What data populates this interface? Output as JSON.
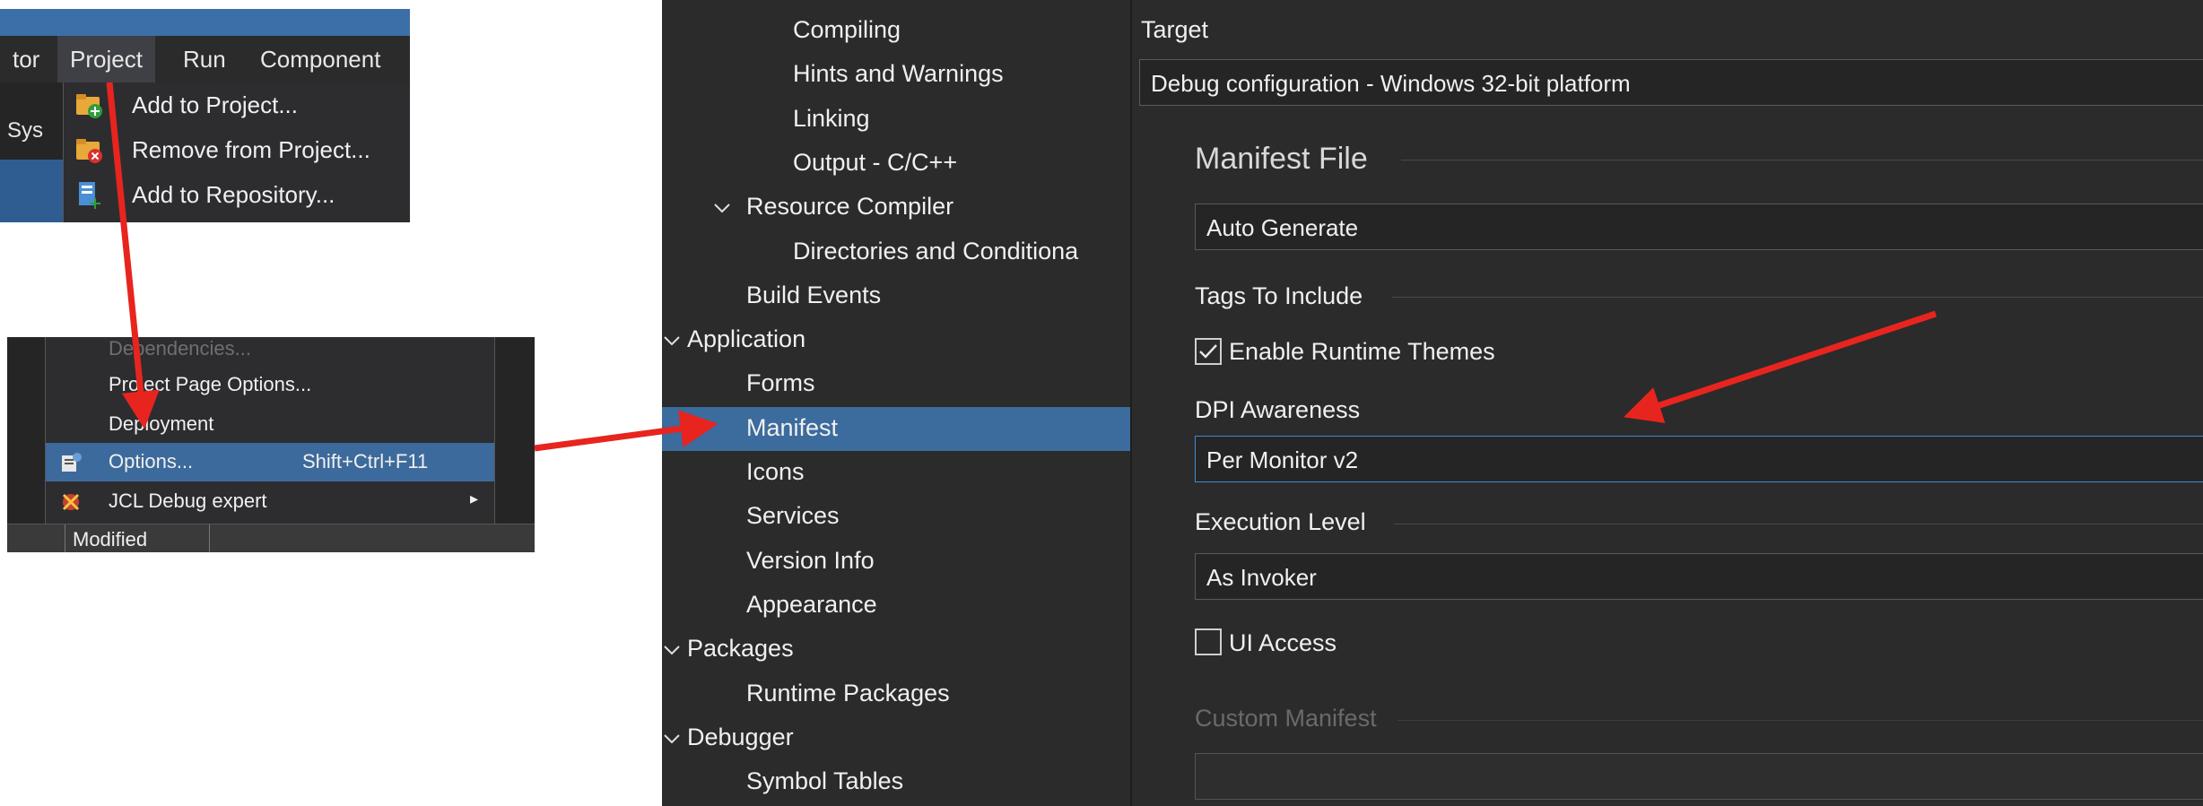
{
  "crop1": {
    "menubar": [
      "tor",
      "Project",
      "Run",
      "Component"
    ],
    "sys_label": "Sys",
    "dropdown": [
      {
        "label": "Add to Project...",
        "icon": "folder-add-icon"
      },
      {
        "label": "Remove from Project...",
        "icon": "folder-remove-icon"
      },
      {
        "label": "Add to Repository...",
        "icon": "repository-add-icon"
      }
    ]
  },
  "crop2": {
    "items": [
      {
        "label": "Dependencies...",
        "faded": true
      },
      {
        "label": "Project Page Options..."
      },
      {
        "label": "Deployment"
      },
      {
        "label": "Options...",
        "shortcut": "Shift+Ctrl+F11",
        "highlighted": true,
        "icon": "options-icon"
      },
      {
        "label": "JCL Debug expert",
        "submenu": true,
        "icon": "jcl-debug-icon"
      }
    ],
    "status": "Modified"
  },
  "tree": [
    {
      "label": "Compiling",
      "indent": 3
    },
    {
      "label": "Hints and Warnings",
      "indent": 3
    },
    {
      "label": "Linking",
      "indent": 3
    },
    {
      "label": "Output - C/C++",
      "indent": 3
    },
    {
      "label": "Resource Compiler",
      "indent": 2,
      "expanded": true
    },
    {
      "label": "Directories and Conditiona",
      "indent": 3
    },
    {
      "label": "Build Events",
      "indent": 2
    },
    {
      "label": "Application",
      "indent": 1,
      "expanded": true
    },
    {
      "label": "Forms",
      "indent": 2
    },
    {
      "label": "Manifest",
      "indent": 2,
      "selected": true
    },
    {
      "label": "Icons",
      "indent": 2
    },
    {
      "label": "Services",
      "indent": 2
    },
    {
      "label": "Version Info",
      "indent": 2
    },
    {
      "label": "Appearance",
      "indent": 2
    },
    {
      "label": "Packages",
      "indent": 1,
      "expanded": true
    },
    {
      "label": "Runtime Packages",
      "indent": 2
    },
    {
      "label": "Debugger",
      "indent": 1,
      "expanded": true
    },
    {
      "label": "Symbol Tables",
      "indent": 2
    }
  ],
  "panel": {
    "target_label": "Target",
    "target_value": "Debug configuration - Windows 32-bit platform",
    "manifest_file_heading": "Manifest File",
    "manifest_value": "Auto Generate",
    "tags_heading": "Tags To Include",
    "enable_runtime_themes": "Enable Runtime Themes",
    "enable_runtime_themes_checked": true,
    "dpi_label": "DPI Awareness",
    "dpi_value": "Per Monitor v2",
    "execution_label": "Execution Level",
    "execution_value": "As Invoker",
    "ui_access": "UI Access",
    "ui_access_checked": false,
    "custom_manifest": "Custom Manifest"
  },
  "colors": {
    "arrow": "#e8241f",
    "selection": "#3c6b9d"
  }
}
